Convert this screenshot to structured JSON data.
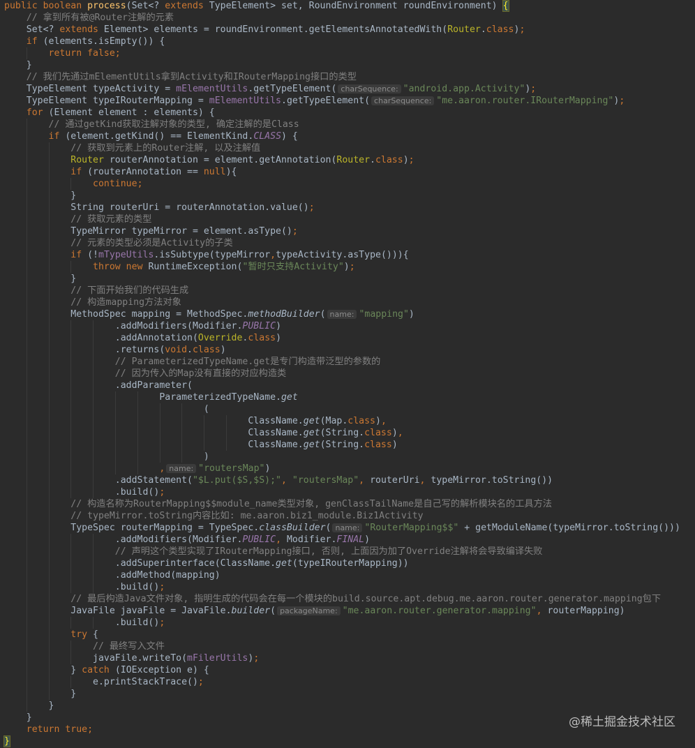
{
  "editor": {
    "theme_colors": {
      "background": "#2b2b2b",
      "default": "#a9b7c6",
      "keyword": "#cc7832",
      "string": "#6a8759",
      "comment": "#808080",
      "method": "#ffc66d",
      "annotation": "#bbb529",
      "field": "#9876aa"
    },
    "lines": [
      {
        "indent": 0,
        "tokens": [
          [
            "kw",
            "public boolean "
          ],
          [
            "fn",
            "process"
          ],
          [
            "",
            "(Set<? "
          ],
          [
            "kw",
            "extends"
          ],
          [
            "",
            " TypeElement> set, RoundEnvironment roundEnvironment) "
          ],
          [
            "brace",
            "{"
          ]
        ]
      },
      {
        "indent": 4,
        "tokens": [
          [
            "com",
            "// 拿到所有被@Router注解的元素"
          ]
        ]
      },
      {
        "indent": 4,
        "tokens": [
          [
            "",
            "Set<? "
          ],
          [
            "kw",
            "extends"
          ],
          [
            "",
            " Element> elements = roundEnvironment.getElementsAnnotatedWith("
          ],
          [
            "ann",
            "Router"
          ],
          [
            "",
            "."
          ],
          [
            "kw",
            "class"
          ],
          [
            "",
            ")"
          ],
          [
            "kw",
            ";"
          ]
        ]
      },
      {
        "indent": 4,
        "tokens": [
          [
            "kw",
            "if"
          ],
          [
            "",
            " (elements.isEmpty()) {"
          ]
        ]
      },
      {
        "indent": 8,
        "tokens": [
          [
            "kw",
            "return false;"
          ]
        ]
      },
      {
        "indent": 4,
        "tokens": [
          [
            "",
            "}"
          ]
        ]
      },
      {
        "indent": 4,
        "tokens": [
          [
            "com",
            "// 我们先通过mElementUtils拿到Activity和IRouterMapping接口的类型"
          ]
        ]
      },
      {
        "indent": 4,
        "tokens": [
          [
            "",
            "TypeElement typeActivity = "
          ],
          [
            "fld",
            "mElementUtils"
          ],
          [
            "",
            ".getTypeElement("
          ],
          [
            "hint",
            "charSequence:"
          ],
          [
            "str",
            "\"android.app.Activity\""
          ],
          [
            "",
            ")"
          ],
          [
            "kw",
            ";"
          ]
        ]
      },
      {
        "indent": 4,
        "tokens": [
          [
            "",
            "TypeElement typeIRouterMapping = "
          ],
          [
            "fld",
            "mElementUtils"
          ],
          [
            "",
            ".getTypeElement("
          ],
          [
            "hint",
            "charSequence:"
          ],
          [
            "str",
            "\"me.aaron.router.IRouterMapping\""
          ],
          [
            "",
            ")"
          ],
          [
            "kw",
            ";"
          ]
        ]
      },
      {
        "indent": 4,
        "tokens": [
          [
            "kw",
            "for"
          ],
          [
            "",
            " (Element element : elements) {"
          ]
        ]
      },
      {
        "indent": 8,
        "tokens": [
          [
            "com",
            "// 通过getKind获取注解对象的类型, 确定注解的是Class"
          ]
        ]
      },
      {
        "indent": 8,
        "tokens": [
          [
            "kw",
            "if"
          ],
          [
            "",
            " (element.getKind() == ElementKind."
          ],
          [
            "fld it",
            "CLASS"
          ],
          [
            "",
            ") {"
          ]
        ]
      },
      {
        "indent": 12,
        "tokens": [
          [
            "com",
            "// 获取到元素上的Router注解, 以及注解值"
          ]
        ]
      },
      {
        "indent": 12,
        "tokens": [
          [
            "ann",
            "Router"
          ],
          [
            "",
            " routerAnnotation = element.getAnnotation("
          ],
          [
            "ann",
            "Router"
          ],
          [
            "",
            "."
          ],
          [
            "kw",
            "class"
          ],
          [
            "",
            ")"
          ],
          [
            "kw",
            ";"
          ]
        ]
      },
      {
        "indent": 12,
        "tokens": [
          [
            "kw",
            "if"
          ],
          [
            "",
            " (routerAnnotation == "
          ],
          [
            "kw",
            "null"
          ],
          [
            "",
            "){"
          ]
        ]
      },
      {
        "indent": 16,
        "tokens": [
          [
            "kw",
            "continue;"
          ]
        ]
      },
      {
        "indent": 12,
        "tokens": [
          [
            "",
            "}"
          ]
        ]
      },
      {
        "indent": 12,
        "tokens": [
          [
            "",
            "String routerUri = routerAnnotation.value()"
          ],
          [
            "kw",
            ";"
          ]
        ]
      },
      {
        "indent": 12,
        "tokens": [
          [
            "com",
            "// 获取元素的类型"
          ]
        ]
      },
      {
        "indent": 12,
        "tokens": [
          [
            "",
            "TypeMirror typeMirror = element.asType()"
          ],
          [
            "kw",
            ";"
          ]
        ]
      },
      {
        "indent": 12,
        "tokens": [
          [
            "com",
            "// 元素的类型必须是Activity的子类"
          ]
        ]
      },
      {
        "indent": 12,
        "tokens": [
          [
            "kw",
            "if"
          ],
          [
            "",
            " (!"
          ],
          [
            "fld",
            "mTypeUtils"
          ],
          [
            "",
            ".isSubtype(typeMirror"
          ],
          [
            "kw",
            ","
          ],
          [
            "",
            "typeActivity.asType())){"
          ]
        ]
      },
      {
        "indent": 16,
        "tokens": [
          [
            "kw",
            "throw new "
          ],
          [
            "",
            "RuntimeException("
          ],
          [
            "str",
            "\"暂时只支持Activity\""
          ],
          [
            "",
            ")"
          ],
          [
            "kw",
            ";"
          ]
        ]
      },
      {
        "indent": 12,
        "tokens": [
          [
            "",
            "}"
          ]
        ]
      },
      {
        "indent": 12,
        "tokens": [
          [
            "com",
            "// 下面开始我们的代码生成"
          ]
        ]
      },
      {
        "indent": 12,
        "tokens": [
          [
            "com",
            "// 构造mapping方法对象"
          ]
        ]
      },
      {
        "indent": 12,
        "tokens": [
          [
            "",
            "MethodSpec mapping = MethodSpec."
          ],
          [
            "it",
            "methodBuilder"
          ],
          [
            "",
            "("
          ],
          [
            "hint",
            "name:"
          ],
          [
            "str",
            "\"mapping\""
          ],
          [
            "",
            ")"
          ]
        ]
      },
      {
        "indent": 20,
        "tokens": [
          [
            "",
            ".addModifiers(Modifier."
          ],
          [
            "fld it",
            "PUBLIC"
          ],
          [
            "",
            ")"
          ]
        ]
      },
      {
        "indent": 20,
        "tokens": [
          [
            "",
            ".addAnnotation("
          ],
          [
            "ann",
            "Override"
          ],
          [
            "",
            "."
          ],
          [
            "kw",
            "class"
          ],
          [
            "",
            ")"
          ]
        ]
      },
      {
        "indent": 20,
        "tokens": [
          [
            "",
            ".returns("
          ],
          [
            "kw",
            "void"
          ],
          [
            "",
            "."
          ],
          [
            "kw",
            "class"
          ],
          [
            "",
            ")"
          ]
        ]
      },
      {
        "indent": 20,
        "tokens": [
          [
            "com",
            "// ParameterizedTypeName.get是专门构造带泛型的参数的"
          ]
        ]
      },
      {
        "indent": 20,
        "tokens": [
          [
            "com",
            "// 因为传入的Map没有直接的对应构造类"
          ]
        ]
      },
      {
        "indent": 20,
        "tokens": [
          [
            "",
            ".addParameter("
          ]
        ]
      },
      {
        "indent": 28,
        "tokens": [
          [
            "",
            "ParameterizedTypeName."
          ],
          [
            "it",
            "get"
          ]
        ]
      },
      {
        "indent": 36,
        "tokens": [
          [
            "",
            "("
          ]
        ]
      },
      {
        "indent": 44,
        "tokens": [
          [
            "",
            "ClassName."
          ],
          [
            "it",
            "get"
          ],
          [
            "",
            "(Map."
          ],
          [
            "kw",
            "class"
          ],
          [
            "",
            ")"
          ],
          [
            "kw",
            ","
          ]
        ]
      },
      {
        "indent": 44,
        "tokens": [
          [
            "",
            "ClassName."
          ],
          [
            "it",
            "get"
          ],
          [
            "",
            "(String."
          ],
          [
            "kw",
            "class"
          ],
          [
            "",
            ")"
          ],
          [
            "kw",
            ","
          ]
        ]
      },
      {
        "indent": 44,
        "tokens": [
          [
            "",
            "ClassName."
          ],
          [
            "it",
            "get"
          ],
          [
            "",
            "(String."
          ],
          [
            "kw",
            "class"
          ],
          [
            "",
            ")"
          ]
        ]
      },
      {
        "indent": 36,
        "tokens": [
          [
            "",
            ")"
          ]
        ]
      },
      {
        "indent": 28,
        "tokens": [
          [
            "kw",
            ","
          ],
          [
            "hint",
            "name:"
          ],
          [
            "str",
            "\"routersMap\""
          ],
          [
            "",
            ")"
          ]
        ]
      },
      {
        "indent": 20,
        "tokens": [
          [
            "",
            ".addStatement("
          ],
          [
            "str",
            "\"$L.put($S,$S);\""
          ],
          [
            "kw",
            ", "
          ],
          [
            "str",
            "\"routersMap\""
          ],
          [
            "kw",
            ", "
          ],
          [
            "",
            "routerUri"
          ],
          [
            "kw",
            ", "
          ],
          [
            "",
            "typeMirror.toString())"
          ]
        ]
      },
      {
        "indent": 20,
        "tokens": [
          [
            "",
            ".build()"
          ],
          [
            "kw",
            ";"
          ]
        ]
      },
      {
        "indent": 12,
        "tokens": [
          [
            "com",
            "// 构造名称为RouterMapping$$module_name类型对象, genClassTailName是自己写的解析模块名的工具方法"
          ]
        ]
      },
      {
        "indent": 12,
        "tokens": [
          [
            "com",
            "// typeMirror.toString内容比如: me.aaron.biz1_module.Biz1Activity"
          ]
        ]
      },
      {
        "indent": 12,
        "tokens": [
          [
            "",
            "TypeSpec routerMapping = TypeSpec."
          ],
          [
            "it",
            "classBuilder"
          ],
          [
            "",
            "("
          ],
          [
            "hint",
            "name:"
          ],
          [
            "str",
            "\"RouterMapping$$\""
          ],
          [
            "",
            " + getModuleName(typeMirror.toString()))"
          ]
        ]
      },
      {
        "indent": 20,
        "tokens": [
          [
            "",
            ".addModifiers(Modifier."
          ],
          [
            "fld it",
            "PUBLIC"
          ],
          [
            "kw",
            ", "
          ],
          [
            "",
            "Modifier."
          ],
          [
            "fld it",
            "FINAL"
          ],
          [
            "",
            ")"
          ]
        ]
      },
      {
        "indent": 20,
        "tokens": [
          [
            "com",
            "// 声明这个类型实现了IRouterMapping接口, 否则, 上面因为加了Override注解将会导致编译失败"
          ]
        ]
      },
      {
        "indent": 20,
        "tokens": [
          [
            "",
            ".addSuperinterface(ClassName."
          ],
          [
            "it",
            "get"
          ],
          [
            "",
            "(typeIRouterMapping))"
          ]
        ]
      },
      {
        "indent": 20,
        "tokens": [
          [
            "",
            ".addMethod(mapping)"
          ]
        ]
      },
      {
        "indent": 20,
        "tokens": [
          [
            "",
            ".build()"
          ],
          [
            "kw",
            ";"
          ]
        ]
      },
      {
        "indent": 12,
        "tokens": [
          [
            "com",
            "// 最后构造Java文件对象, 指明生成的代码会在每一个模块的build.source.apt.debug.me.aaron.router.generator.mapping包下"
          ]
        ]
      },
      {
        "indent": 12,
        "tokens": [
          [
            "",
            "JavaFile javaFile = JavaFile."
          ],
          [
            "it",
            "builder"
          ],
          [
            "",
            "("
          ],
          [
            "hint",
            "packageName:"
          ],
          [
            "str",
            "\"me.aaron.router.generator.mapping\""
          ],
          [
            "kw",
            ", "
          ],
          [
            "",
            "routerMapping)"
          ]
        ]
      },
      {
        "indent": 20,
        "tokens": [
          [
            "",
            ".build()"
          ],
          [
            "kw",
            ";"
          ]
        ]
      },
      {
        "indent": 12,
        "tokens": [
          [
            "kw",
            "try"
          ],
          [
            "",
            " {"
          ]
        ]
      },
      {
        "indent": 16,
        "tokens": [
          [
            "com",
            "// 最终写入文件"
          ]
        ]
      },
      {
        "indent": 16,
        "tokens": [
          [
            "",
            "javaFile.writeTo("
          ],
          [
            "fld",
            "mFilerUtils"
          ],
          [
            "",
            ")"
          ],
          [
            "kw",
            ";"
          ]
        ]
      },
      {
        "indent": 12,
        "tokens": [
          [
            "",
            "} "
          ],
          [
            "kw",
            "catch"
          ],
          [
            "",
            " (IOException e) {"
          ]
        ]
      },
      {
        "indent": 16,
        "tokens": [
          [
            "",
            "e.printStackTrace()"
          ],
          [
            "kw",
            ";"
          ]
        ]
      },
      {
        "indent": 12,
        "tokens": [
          [
            "",
            "}"
          ]
        ]
      },
      {
        "indent": 8,
        "tokens": [
          [
            "",
            "}"
          ]
        ]
      },
      {
        "indent": 4,
        "tokens": [
          [
            "",
            "}"
          ]
        ]
      },
      {
        "indent": 4,
        "tokens": [
          [
            "kw",
            "return true;"
          ]
        ]
      },
      {
        "indent": 0,
        "tokens": [
          [
            "brace",
            "}"
          ]
        ]
      }
    ]
  },
  "watermark": "@稀土掘金技术社区"
}
